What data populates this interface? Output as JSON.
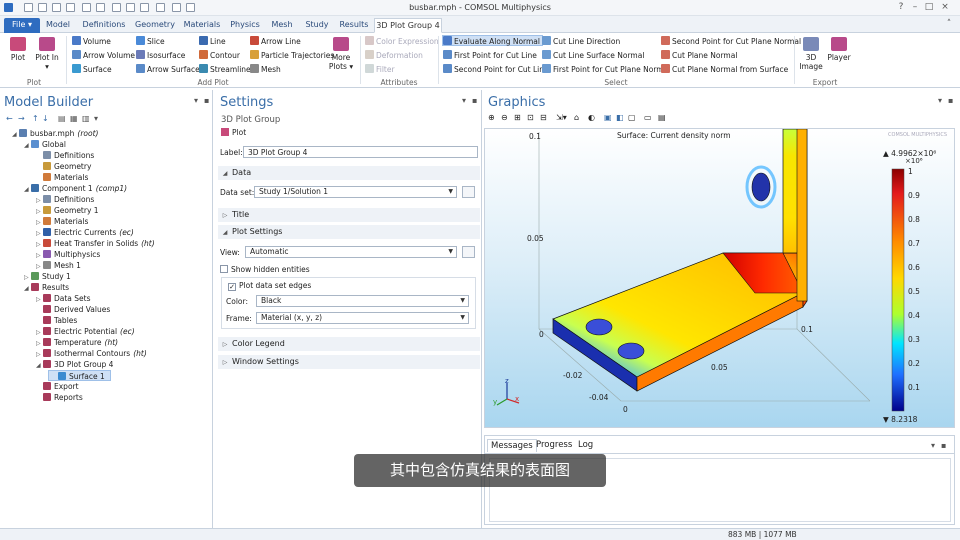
{
  "window": {
    "title": "busbar.mph - COMSOL Multiphysics"
  },
  "tabs": [
    "File ▾",
    "Model",
    "Definitions",
    "Geometry",
    "Materials",
    "Physics",
    "Mesh",
    "Study",
    "Results",
    "3D Plot Group 4"
  ],
  "ribbon": {
    "plot": "Plot",
    "plot_in": "Plot In ▾",
    "plot_group": "Plot",
    "col1": [
      "Volume",
      "Arrow Volume",
      "Surface"
    ],
    "col2": [
      "Slice",
      "Isosurface",
      "Arrow Surface"
    ],
    "col3": [
      "Line",
      "Contour",
      "Streamline"
    ],
    "col4": [
      "Arrow Line",
      "Particle Trajectories",
      "Mesh"
    ],
    "more_plots": "More Plots ▾",
    "add_plot_group": "Add Plot",
    "attributes": [
      "Color Expression",
      "Deformation",
      "Filter"
    ],
    "attributes_group": "Attributes",
    "select_col1": [
      "Evaluate Along Normal",
      "First Point for Cut Line",
      "Second Point for Cut Line"
    ],
    "select_col2": [
      "Cut Line Direction",
      "Cut Line Surface Normal",
      "First Point for Cut Plane Normal"
    ],
    "select_col3": [
      "Second Point for Cut Plane Normal",
      "Cut Plane Normal",
      "Cut Plane Normal from Surface"
    ],
    "select_group": "Select",
    "image_3d": "3D Image",
    "player": "Player",
    "export_group": "Export"
  },
  "model_builder": {
    "title": "Model Builder",
    "tree": [
      {
        "label": "busbar.mph",
        "suffix": "(root)",
        "level": 0,
        "toggle": "◢",
        "color": "#5a7fb0"
      },
      {
        "label": "Global",
        "suffix": "",
        "level": 1,
        "toggle": "◢",
        "color": "#5a8fd0"
      },
      {
        "label": "Definitions",
        "suffix": "",
        "level": 2,
        "toggle": "",
        "color": "#7c8ea8"
      },
      {
        "label": "Geometry",
        "suffix": "",
        "level": 2,
        "toggle": "",
        "color": "#c89a3a"
      },
      {
        "label": "Materials",
        "suffix": "",
        "level": 2,
        "toggle": "",
        "color": "#d07a3a"
      },
      {
        "label": "Component 1",
        "suffix": "(comp1)",
        "level": 1,
        "toggle": "◢",
        "color": "#3a6ea8"
      },
      {
        "label": "Definitions",
        "suffix": "",
        "level": 2,
        "toggle": "▷",
        "color": "#7c8ea8"
      },
      {
        "label": "Geometry 1",
        "suffix": "",
        "level": 2,
        "toggle": "▷",
        "color": "#c89a3a"
      },
      {
        "label": "Materials",
        "suffix": "",
        "level": 2,
        "toggle": "▷",
        "color": "#d07a3a"
      },
      {
        "label": "Electric Currents",
        "suffix": "(ec)",
        "level": 2,
        "toggle": "▷",
        "color": "#2f5fa8"
      },
      {
        "label": "Heat Transfer in Solids",
        "suffix": "(ht)",
        "level": 2,
        "toggle": "▷",
        "color": "#c84a3a"
      },
      {
        "label": "Multiphysics",
        "suffix": "",
        "level": 2,
        "toggle": "▷",
        "color": "#8a5ab0"
      },
      {
        "label": "Mesh 1",
        "suffix": "",
        "level": 2,
        "toggle": "▷",
        "color": "#888888"
      },
      {
        "label": "Study 1",
        "suffix": "",
        "level": 1,
        "toggle": "▷",
        "color": "#5a9a5a"
      },
      {
        "label": "Results",
        "suffix": "",
        "level": 1,
        "toggle": "◢",
        "color": "#a83a5a"
      },
      {
        "label": "Data Sets",
        "suffix": "",
        "level": 2,
        "toggle": "▷",
        "color": "#a83a5a"
      },
      {
        "label": "Derived Values",
        "suffix": "",
        "level": 2,
        "toggle": "",
        "color": "#a83a5a"
      },
      {
        "label": "Tables",
        "suffix": "",
        "level": 2,
        "toggle": "",
        "color": "#a83a5a"
      },
      {
        "label": "Electric Potential",
        "suffix": "(ec)",
        "level": 2,
        "toggle": "▷",
        "color": "#a83a5a"
      },
      {
        "label": "Temperature",
        "suffix": "(ht)",
        "level": 2,
        "toggle": "▷",
        "color": "#a83a5a"
      },
      {
        "label": "Isothermal Contours",
        "suffix": "(ht)",
        "level": 2,
        "toggle": "▷",
        "color": "#a83a5a"
      },
      {
        "label": "3D Plot Group 4",
        "suffix": "",
        "level": 2,
        "toggle": "◢",
        "color": "#a83a5a"
      },
      {
        "label": "Surface 1",
        "suffix": "",
        "level": 3,
        "toggle": "",
        "color": "#3a8ad0",
        "selected": true
      },
      {
        "label": "Export",
        "suffix": "",
        "level": 2,
        "toggle": "",
        "color": "#a83a5a"
      },
      {
        "label": "Reports",
        "suffix": "",
        "level": 2,
        "toggle": "",
        "color": "#a83a5a"
      }
    ]
  },
  "settings": {
    "title": "Settings",
    "subtitle": "3D Plot Group",
    "plot_button": "Plot",
    "label_caption": "Label:",
    "label_value": "3D Plot Group 4",
    "sec_data": "Data",
    "dataset_caption": "Data set:",
    "dataset_value": "Study 1/Solution 1",
    "sec_title": "Title",
    "sec_plot_settings": "Plot Settings",
    "view_caption": "View:",
    "view_value": "Automatic",
    "show_hidden": "Show hidden entities",
    "plot_edges": "Plot data set edges",
    "color_caption": "Color:",
    "color_value": "Black",
    "frame_caption": "Frame:",
    "frame_value": "Material  (x, y, z)",
    "sec_color_legend": "Color Legend",
    "sec_window_settings": "Window Settings"
  },
  "graphics": {
    "title": "Graphics",
    "plot_title": "Surface: Current density norm",
    "brand": "COMSOL MULTIPHYSICS",
    "legend_max": "▲ 4.9962×10⁶",
    "legend_exp": "×10⁶",
    "legend_min": "▼ 8.2318",
    "legend_ticks": [
      "1",
      "0.9",
      "0.8",
      "0.7",
      "0.6",
      "0.5",
      "0.4",
      "0.3",
      "0.2",
      "0.1"
    ],
    "axis_labels": [
      "0.1",
      "0.05",
      "0",
      "-0.02",
      "-0.04",
      "0",
      "0.05",
      "0.1"
    ],
    "triad": [
      "z",
      "y",
      "x"
    ]
  },
  "messages": {
    "tabs": [
      "Messages",
      "Progress",
      "Log"
    ]
  },
  "status": {
    "memory": "883 MB | 1077 MB"
  },
  "subtitle": "其中包含仿真结果的表面图",
  "colors": {
    "accent": "#2e6cc0",
    "title_blue": "#3a6ea8"
  }
}
